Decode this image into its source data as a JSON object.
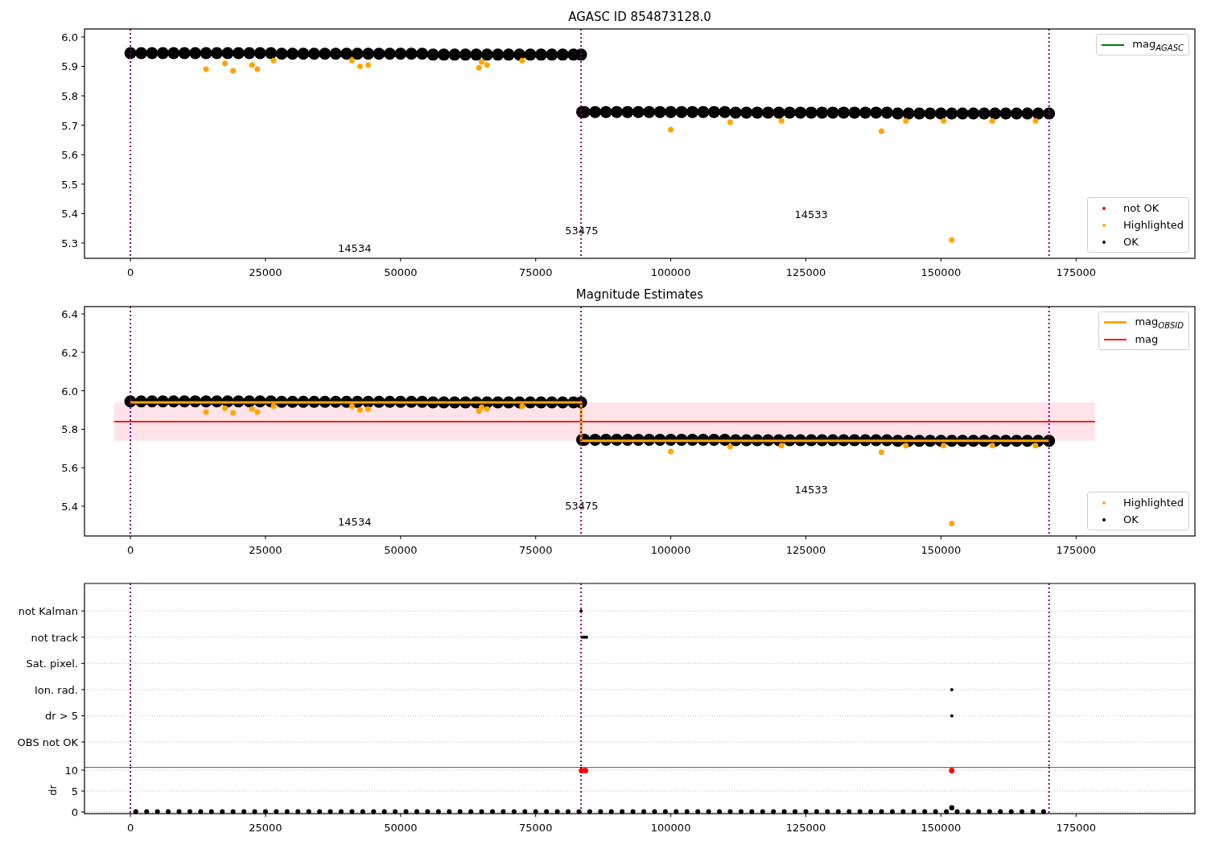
{
  "panels": [
    {
      "chart_data": {
        "type": "scatter",
        "title": "AGASC ID 854873128.0",
        "xlim": [
          -8500,
          197000
        ],
        "ylim": [
          5.248,
          6.027
        ],
        "xticks": [
          0,
          25000,
          50000,
          75000,
          100000,
          125000,
          150000,
          175000
        ],
        "yticks": [
          {
            "value": 5.3,
            "label": "5.3"
          },
          {
            "value": 5.4,
            "label": "5.4"
          },
          {
            "value": 5.5,
            "label": "5.5"
          },
          {
            "value": 5.6,
            "label": "5.6"
          },
          {
            "value": 5.7,
            "label": "5.7"
          },
          {
            "value": 5.8,
            "label": "5.8"
          },
          {
            "value": 5.9,
            "label": "5.9"
          },
          {
            "value": 6.0,
            "label": "6.0"
          }
        ],
        "series": [
          {
            "name": "mag$_{AGASC}$",
            "color": "#008000",
            "type": "line"
          },
          {
            "name": "not OK",
            "color": "#ff0000",
            "type": "scatter"
          },
          {
            "name": "Highlighted",
            "color": "#ffa500",
            "type": "scatter",
            "x": [
              14000,
              17500,
              19000,
              22500,
              23500,
              26500,
              41000,
              42500,
              44000,
              64500,
              65000,
              66000,
              72500,
              100000,
              111000,
              120500,
              139000,
              143500,
              150500,
              152000,
              159500,
              167500
            ],
            "values": [
              5.89,
              5.91,
              5.885,
              5.905,
              5.89,
              5.92,
              5.92,
              5.9,
              5.905,
              5.895,
              5.915,
              5.905,
              5.92,
              5.685,
              5.71,
              5.715,
              5.68,
              5.715,
              5.715,
              5.31,
              5.715,
              5.715
            ]
          },
          {
            "name": "OK",
            "color": "#000000",
            "type": "scatter",
            "x": [
              0,
              2000,
              4000,
              6000,
              8000,
              10000,
              12000,
              14000,
              16000,
              18000,
              20000,
              22000,
              24000,
              26000,
              28000,
              30000,
              32000,
              34000,
              36000,
              38000,
              40000,
              42000,
              44000,
              46000,
              48000,
              50000,
              52000,
              54000,
              56000,
              58000,
              60000,
              62000,
              64000,
              66000,
              68000,
              70000,
              72000,
              74000,
              76000,
              78000,
              80000,
              82000,
              83400,
              83600,
              84000,
              86000,
              88000,
              90000,
              92000,
              94000,
              96000,
              98000,
              100000,
              102000,
              104000,
              106000,
              108000,
              110000,
              112000,
              114000,
              116000,
              118000,
              120000,
              122000,
              124000,
              126000,
              128000,
              130000,
              132000,
              134000,
              136000,
              138000,
              140000,
              142000,
              144000,
              146000,
              148000,
              150000,
              152000,
              154000,
              156000,
              158000,
              160000,
              162000,
              164000,
              166000,
              168000,
              170000
            ],
            "values": [
              5.945,
              5.945,
              5.945,
              5.945,
              5.945,
              5.945,
              5.945,
              5.945,
              5.945,
              5.945,
              5.945,
              5.945,
              5.945,
              5.945,
              5.943,
              5.943,
              5.943,
              5.943,
              5.943,
              5.943,
              5.943,
              5.943,
              5.943,
              5.943,
              5.943,
              5.943,
              5.943,
              5.943,
              5.94,
              5.94,
              5.94,
              5.94,
              5.94,
              5.94,
              5.94,
              5.94,
              5.94,
              5.94,
              5.94,
              5.94,
              5.94,
              5.94,
              5.94,
              5.745,
              5.745,
              5.745,
              5.745,
              5.745,
              5.745,
              5.745,
              5.745,
              5.745,
              5.745,
              5.745,
              5.745,
              5.745,
              5.745,
              5.745,
              5.743,
              5.743,
              5.743,
              5.743,
              5.743,
              5.743,
              5.743,
              5.743,
              5.743,
              5.743,
              5.743,
              5.743,
              5.743,
              5.743,
              5.743,
              5.74,
              5.74,
              5.74,
              5.74,
              5.74,
              5.74,
              5.74,
              5.74,
              5.74,
              5.74,
              5.74,
              5.74,
              5.74,
              5.74,
              5.74
            ]
          }
        ],
        "ref_lines": [
          {
            "axis": "x",
            "value": 0,
            "color": "#800080"
          },
          {
            "axis": "x",
            "value": 83400,
            "color": "#800080"
          },
          {
            "axis": "x",
            "value": 170000,
            "color": "#800080"
          }
        ],
        "annotations": [
          "14534",
          "53475",
          "14533"
        ]
      }
    },
    {
      "chart_data": {
        "type": "scatter",
        "title": "Magnitude Estimates",
        "xlim": [
          -8500,
          197000
        ],
        "ylim": [
          5.245,
          6.438
        ],
        "xticks": [
          0,
          25000,
          50000,
          75000,
          100000,
          125000,
          150000,
          175000
        ],
        "yticks": [
          {
            "value": 5.4,
            "label": "5.4"
          },
          {
            "value": 5.6,
            "label": "5.6"
          },
          {
            "value": 5.8,
            "label": "5.8"
          },
          {
            "value": 6.0,
            "label": "6.0"
          },
          {
            "value": 6.2,
            "label": "6.2"
          },
          {
            "value": 6.4,
            "label": "6.4"
          }
        ],
        "series": [
          {
            "name": "mag$_{OBSID}$",
            "color": "#ffa500",
            "type": "line",
            "x": [
              0,
              83400,
              83400,
              170000
            ],
            "values": [
              5.94,
              5.94,
              5.74,
              5.74
            ]
          },
          {
            "name": "mag",
            "color": "#ff0000",
            "type": "line",
            "x": [
              -3000,
              178500
            ],
            "values": [
              5.84,
              5.84
            ]
          },
          {
            "name": "Highlighted",
            "color": "#ffa500",
            "type": "scatter",
            "x": [
              14000,
              17500,
              19000,
              22500,
              23500,
              26500,
              41000,
              42500,
              44000,
              64500,
              65000,
              66000,
              72500,
              100000,
              111000,
              120500,
              139000,
              143500,
              150500,
              152000,
              159500,
              167500
            ],
            "values": [
              5.89,
              5.91,
              5.885,
              5.905,
              5.89,
              5.92,
              5.92,
              5.9,
              5.905,
              5.895,
              5.915,
              5.905,
              5.92,
              5.685,
              5.71,
              5.715,
              5.68,
              5.715,
              5.715,
              5.31,
              5.715,
              5.715
            ]
          },
          {
            "name": "OK",
            "color": "#000000",
            "type": "scatter",
            "x": [
              0,
              2000,
              4000,
              6000,
              8000,
              10000,
              12000,
              14000,
              16000,
              18000,
              20000,
              22000,
              24000,
              26000,
              28000,
              30000,
              32000,
              34000,
              36000,
              38000,
              40000,
              42000,
              44000,
              46000,
              48000,
              50000,
              52000,
              54000,
              56000,
              58000,
              60000,
              62000,
              64000,
              66000,
              68000,
              70000,
              72000,
              74000,
              76000,
              78000,
              80000,
              82000,
              83400,
              83600,
              84000,
              86000,
              88000,
              90000,
              92000,
              94000,
              96000,
              98000,
              100000,
              102000,
              104000,
              106000,
              108000,
              110000,
              112000,
              114000,
              116000,
              118000,
              120000,
              122000,
              124000,
              126000,
              128000,
              130000,
              132000,
              134000,
              136000,
              138000,
              140000,
              142000,
              144000,
              146000,
              148000,
              150000,
              152000,
              154000,
              156000,
              158000,
              160000,
              162000,
              164000,
              166000,
              168000,
              170000
            ],
            "values": [
              5.945,
              5.945,
              5.945,
              5.945,
              5.945,
              5.945,
              5.945,
              5.945,
              5.945,
              5.945,
              5.945,
              5.945,
              5.945,
              5.945,
              5.943,
              5.943,
              5.943,
              5.943,
              5.943,
              5.943,
              5.943,
              5.943,
              5.943,
              5.943,
              5.943,
              5.943,
              5.943,
              5.943,
              5.94,
              5.94,
              5.94,
              5.94,
              5.94,
              5.94,
              5.94,
              5.94,
              5.94,
              5.94,
              5.94,
              5.94,
              5.94,
              5.94,
              5.94,
              5.745,
              5.745,
              5.745,
              5.745,
              5.745,
              5.745,
              5.745,
              5.745,
              5.745,
              5.745,
              5.745,
              5.745,
              5.745,
              5.745,
              5.745,
              5.743,
              5.743,
              5.743,
              5.743,
              5.743,
              5.743,
              5.743,
              5.743,
              5.743,
              5.743,
              5.743,
              5.743,
              5.743,
              5.743,
              5.743,
              5.74,
              5.74,
              5.74,
              5.74,
              5.74,
              5.74,
              5.74,
              5.74,
              5.74,
              5.74,
              5.74,
              5.74,
              5.74,
              5.74,
              5.74
            ]
          }
        ],
        "bands": [
          {
            "axis": "y",
            "from": 5.74,
            "to": 5.94,
            "color": "#ffc0cb"
          }
        ],
        "ref_lines": [
          {
            "axis": "x",
            "value": 0,
            "color": "#800080"
          },
          {
            "axis": "x",
            "value": 83400,
            "color": "#800080"
          },
          {
            "axis": "x",
            "value": 170000,
            "color": "#800080"
          }
        ],
        "annotations": [
          "14534",
          "53475",
          "14533"
        ]
      }
    },
    {
      "flag_rows": [
        "not Kalman",
        "not track",
        "Sat. pixel.",
        "Ion. rad.",
        "dr > 5",
        "OBS not OK"
      ]
    },
    {
      "chart_data": {
        "type": "scatter",
        "ylabel": "dr",
        "xlim": [
          -8500,
          197000
        ],
        "ylim": [
          -0.38,
          10.77
        ],
        "xticks": [
          0,
          25000,
          50000,
          75000,
          100000,
          125000,
          150000,
          175000
        ],
        "yticks": [
          {
            "value": 0,
            "label": "0"
          },
          {
            "value": 5,
            "label": "5"
          },
          {
            "value": 10,
            "label": "10"
          }
        ],
        "series": [
          {
            "color": "#000000",
            "type": "scatter",
            "x": [
              1000,
              3000,
              5000,
              7000,
              9000,
              11000,
              13000,
              15000,
              17000,
              19000,
              21000,
              23000,
              25000,
              27000,
              29000,
              31000,
              33000,
              35000,
              37000,
              39000,
              41000,
              43000,
              45000,
              47000,
              49000,
              51000,
              53000,
              55000,
              57000,
              59000,
              61000,
              63000,
              65000,
              67000,
              69000,
              71000,
              73000,
              75000,
              77000,
              79000,
              81000,
              83000,
              85000,
              87000,
              89000,
              91000,
              93000,
              95000,
              97000,
              99000,
              101000,
              103000,
              105000,
              107000,
              109000,
              111000,
              113000,
              115000,
              117000,
              119000,
              121000,
              123000,
              125000,
              127000,
              129000,
              131000,
              133000,
              135000,
              137000,
              139000,
              141000,
              143000,
              145000,
              147000,
              149000,
              151000,
              153000,
              155000,
              157000,
              159000,
              161000,
              163000,
              165000,
              167000,
              169000
            ],
            "values": [
              0.1,
              0.1,
              0.1,
              0.1,
              0.1,
              0.1,
              0.1,
              0.1,
              0.1,
              0.1,
              0.1,
              0.1,
              0.1,
              0.1,
              0.1,
              0.1,
              0.1,
              0.1,
              0.1,
              0.1,
              0.1,
              0.1,
              0.1,
              0.1,
              0.1,
              0.1,
              0.1,
              0.1,
              0.1,
              0.1,
              0.1,
              0.1,
              0.1,
              0.1,
              0.1,
              0.1,
              0.1,
              0.1,
              0.1,
              0.1,
              0.1,
              0.1,
              0.1,
              0.1,
              0.1,
              0.1,
              0.1,
              0.1,
              0.1,
              0.1,
              0.1,
              0.1,
              0.1,
              0.1,
              0.1,
              0.1,
              0.1,
              0.1,
              0.1,
              0.1,
              0.1,
              0.1,
              0.1,
              0.1,
              0.1,
              0.1,
              0.1,
              0.1,
              0.1,
              0.1,
              0.1,
              0.1,
              0.1,
              0.1,
              0.1,
              0.1,
              0.1,
              0.1,
              0.1,
              0.1,
              0.1,
              0.1,
              0.1,
              0.1,
              0.1
            ]
          },
          {
            "color": "#ff0000",
            "type": "scatter",
            "x": [
              83500,
              84200,
              152000
            ],
            "values": [
              9.9,
              9.9,
              9.9
            ]
          },
          {
            "color": "#000000",
            "type": "scatter",
            "x": [
              152000
            ],
            "values": [
              1
            ]
          }
        ],
        "ref_lines": [
          {
            "axis": "x",
            "value": 0,
            "color": "#800080"
          },
          {
            "axis": "x",
            "value": 83400,
            "color": "#800080"
          },
          {
            "axis": "x",
            "value": 170000,
            "color": "#800080"
          }
        ]
      }
    }
  ]
}
